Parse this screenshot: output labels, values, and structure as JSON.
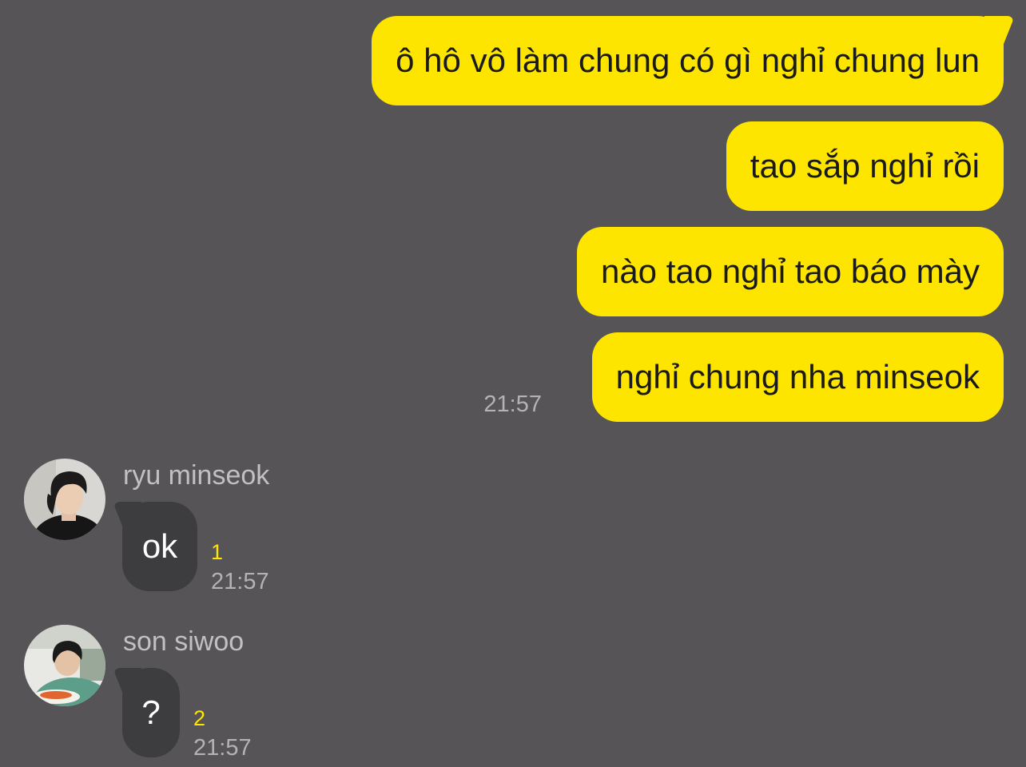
{
  "colors": {
    "background": "#565456",
    "outgoing_bubble": "#fde500",
    "incoming_bubble": "#3d3c3e",
    "timestamp": "#b4b3b4",
    "unread_count": "#fde500"
  },
  "outgoing": {
    "messages": [
      {
        "text": "ô hô vô làm chung có gì nghỉ chung lun"
      },
      {
        "text": "tao sắp nghỉ rồi"
      },
      {
        "text": "nào tao nghỉ tao báo mày"
      },
      {
        "text": "nghỉ chung nha minseok"
      }
    ],
    "time": "21:57"
  },
  "incoming": [
    {
      "sender": "ryu minseok",
      "avatar_icon": "profile-photo",
      "text": "ok",
      "unread": "1",
      "time": "21:57"
    },
    {
      "sender": "son siwoo",
      "avatar_icon": "profile-photo",
      "text": "?",
      "unread": "2",
      "time": "21:57"
    }
  ]
}
